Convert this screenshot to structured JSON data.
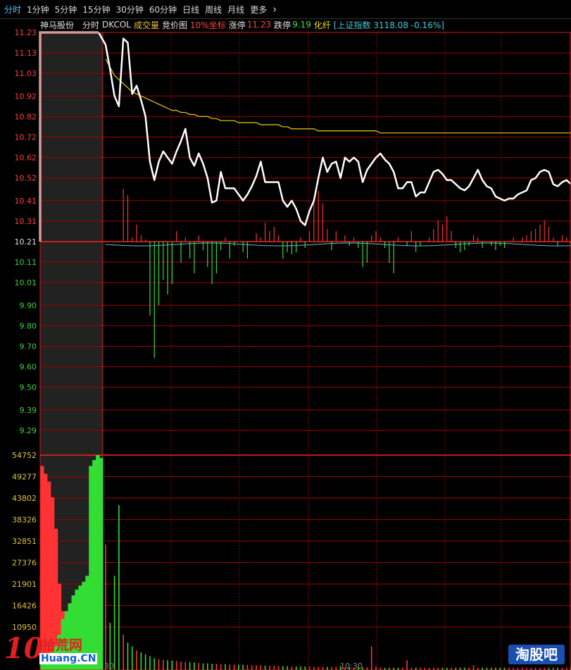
{
  "toolbar": {
    "items": [
      "分时",
      "1分钟",
      "5分钟",
      "15分钟",
      "30分钟",
      "60分钟",
      "日线",
      "周线",
      "月线",
      "更多"
    ],
    "more_icon": "chevron-right-icon"
  },
  "infobar": {
    "stock_name": "神马股份",
    "mode": "分时",
    "indicator": "DKCOL",
    "volume_label": "成交量",
    "auction_label": "竞价图",
    "coord_label": "10%坐标",
    "limit_up_label": "涨停",
    "limit_up_value": "11.23",
    "limit_down_label": "跌停",
    "limit_down_value": "9.19",
    "fiber_label": "化纤",
    "index_text": "[上证指数 3118.08 -0.16%]"
  },
  "colors": {
    "grid": "#a00000",
    "up": "#ff3333",
    "down": "#33dd33",
    "price_line": "#ffffff",
    "avg_line": "#e8d000",
    "index_line": "#55c8c8"
  },
  "price_axis": [
    "11.23",
    "11.13",
    "11.03",
    "10.92",
    "10.82",
    "10.72",
    "10.62",
    "10.52",
    "10.41",
    "10.31",
    "10.21",
    "10.11",
    "10.01",
    "9.90",
    "9.80",
    "9.70",
    "9.60",
    "9.50",
    "9.39",
    "9.29"
  ],
  "volume_axis": [
    "54752",
    "49277",
    "43802",
    "38326",
    "32851",
    "27376",
    "21901",
    "16426",
    "10950"
  ],
  "time_labels": [
    "09:30",
    "10:30"
  ],
  "chart_data": {
    "type": "line",
    "prev_close": 10.21,
    "ylim": [
      9.19,
      11.23
    ],
    "auction_price": 11.23,
    "price": [
      11.17,
      11.05,
      10.92,
      10.87,
      11.2,
      11.18,
      10.93,
      10.97,
      10.9,
      10.82,
      10.6,
      10.51,
      10.6,
      10.65,
      10.62,
      10.59,
      10.65,
      10.7,
      10.76,
      10.62,
      10.58,
      10.64,
      10.59,
      10.52,
      10.4,
      10.41,
      10.55,
      10.47,
      10.47,
      10.47,
      10.44,
      10.41,
      10.44,
      10.48,
      10.53,
      10.6,
      10.5,
      10.5,
      10.5,
      10.5,
      10.41,
      10.38,
      10.41,
      10.37,
      10.31,
      10.29,
      10.36,
      10.41,
      10.52,
      10.62,
      10.55,
      10.59,
      10.6,
      10.52,
      10.62,
      10.6,
      10.62,
      10.6,
      10.5,
      10.56,
      10.59,
      10.62,
      10.64,
      10.61,
      10.59,
      10.55,
      10.47,
      10.47,
      10.5,
      10.5,
      10.43,
      10.45,
      10.45,
      10.5,
      10.55,
      10.56,
      10.54,
      10.51,
      10.51,
      10.49,
      10.47,
      10.46,
      10.48,
      10.52,
      10.56,
      10.51,
      10.48,
      10.47,
      10.43,
      10.42,
      10.41,
      10.42,
      10.42,
      10.44,
      10.45,
      10.46,
      10.51,
      10.52,
      10.55,
      10.56,
      10.55,
      10.49,
      10.48,
      10.5,
      10.51,
      10.49
    ],
    "avg": [
      11.1,
      11.06,
      11.02,
      11.0,
      10.98,
      10.96,
      10.94,
      10.93,
      10.92,
      10.91,
      10.9,
      10.89,
      10.88,
      10.87,
      10.86,
      10.85,
      10.85,
      10.84,
      10.84,
      10.83,
      10.83,
      10.82,
      10.82,
      10.82,
      10.81,
      10.81,
      10.8,
      10.8,
      10.8,
      10.8,
      10.79,
      10.79,
      10.79,
      10.79,
      10.79,
      10.78,
      10.78,
      10.78,
      10.78,
      10.78,
      10.77,
      10.77,
      10.76,
      10.76,
      10.76,
      10.76,
      10.76,
      10.76,
      10.75,
      10.75,
      10.75,
      10.75,
      10.75,
      10.75,
      10.75,
      10.75,
      10.75,
      10.75,
      10.75,
      10.75,
      10.75,
      10.75,
      10.74,
      10.74,
      10.74,
      10.74,
      10.74,
      10.74,
      10.74,
      10.74,
      10.74,
      10.74,
      10.74,
      10.74,
      10.74,
      10.74,
      10.74,
      10.74,
      10.74,
      10.74,
      10.74,
      10.74,
      10.74,
      10.74,
      10.74,
      10.74,
      10.74,
      10.74,
      10.74,
      10.74,
      10.74,
      10.74,
      10.74,
      10.74,
      10.74,
      10.74,
      10.74,
      10.74,
      10.74,
      10.74,
      10.74,
      10.74,
      10.74,
      10.74,
      10.74,
      10.74
    ],
    "dkcol": [
      0,
      0,
      0,
      0,
      0.25,
      0.22,
      0.02,
      0.08,
      0.03,
      0.01,
      -0.35,
      -0.55,
      -0.3,
      -0.18,
      -0.25,
      -0.2,
      0.05,
      -0.1,
      0.02,
      -0.08,
      -0.15,
      0.03,
      -0.04,
      -0.12,
      -0.2,
      -0.15,
      -0.04,
      0.02,
      -0.08,
      -0.02,
      0.0,
      -0.05,
      -0.08,
      0.0,
      0.04,
      0.02,
      0.09,
      0.05,
      0.07,
      0.03,
      -0.08,
      -0.05,
      -0.06,
      -0.05,
      0.02,
      -0.03,
      0.05,
      0.2,
      0.24,
      0.18,
      0.06,
      -0.04,
      0.05,
      0.0,
      0.03,
      -0.02,
      0.02,
      -0.03,
      -0.12,
      -0.1,
      0.03,
      0.05,
      0.02,
      -0.03,
      -0.1,
      -0.15,
      0.02,
      0.0,
      -0.02,
      0.05,
      -0.05,
      -0.02,
      0.0,
      0.02,
      0.06,
      0.1,
      0.08,
      0.12,
      0.05,
      -0.03,
      -0.05,
      -0.04,
      -0.02,
      0.03,
      0.02,
      -0.03,
      0.0,
      -0.02,
      -0.04,
      -0.02,
      -0.03,
      0.0,
      0.02,
      0.0,
      0.02,
      0.03,
      0.05,
      0.06,
      0.08,
      0.1,
      0.07,
      0.02,
      -0.02,
      0.03,
      0.02,
      -0.01
    ],
    "volume": [
      32000,
      12000,
      24000,
      42000,
      9000,
      7000,
      6000,
      5000,
      4500,
      4000,
      3500,
      3000,
      2800,
      2600,
      2500,
      2400,
      2300,
      2200,
      2100,
      2000,
      1900,
      1800,
      1700,
      1700,
      1600,
      1600,
      1500,
      1500,
      1400,
      1400,
      1300,
      1300,
      1300,
      1200,
      1200,
      1200,
      1100,
      1100,
      1100,
      1000,
      1000,
      1000,
      900,
      900,
      900,
      900,
      900,
      800,
      800,
      800,
      800,
      800,
      800,
      1000,
      700,
      700,
      700,
      700,
      700,
      700,
      6000,
      900,
      600,
      600,
      600,
      600,
      600,
      600,
      2500,
      600,
      600,
      600,
      600,
      600,
      600,
      600,
      600,
      600,
      600,
      600,
      600,
      600,
      600,
      1200,
      600,
      600,
      600,
      600,
      600,
      600,
      600,
      600,
      600,
      600,
      600,
      600,
      600,
      600,
      600,
      600,
      600,
      600,
      600,
      600,
      600,
      600
    ],
    "auction_red": [
      52000,
      50000,
      48000,
      44000,
      36000,
      22000,
      15000,
      12000,
      11000,
      10500,
      11000,
      9500,
      9000,
      8000,
      6000,
      3500,
      2500,
      2000
    ],
    "auction_green": [
      1500,
      2500,
      3500,
      4500,
      6000,
      9000,
      13000,
      15000,
      17000,
      19000,
      20500,
      21500,
      22500,
      24000,
      52000,
      53500,
      54752,
      54000
    ]
  },
  "watermark_left": {
    "number": "10",
    "text": "拾荒网",
    "domain": "Huang.CN"
  },
  "watermark_right": "淘股吧"
}
